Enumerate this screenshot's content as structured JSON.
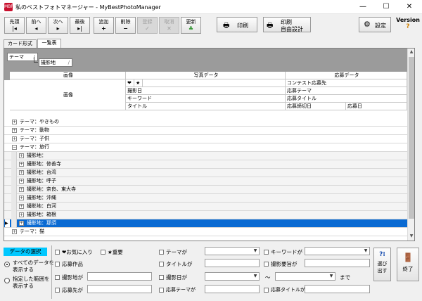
{
  "window": {
    "icon_text": "MBP",
    "title": "私のベストフォトマネージャー - MyBestPhotoManager",
    "minimize": "—",
    "maximize": "☐",
    "close": "✕"
  },
  "toolbar": {
    "first": "先頭",
    "prev": "前へ",
    "next": "次へ",
    "last": "最後",
    "add": "追加",
    "delete": "削除",
    "register": "登録",
    "cancel": "取消",
    "update": "更新",
    "print": "印刷",
    "print_free_line1": "印刷",
    "print_free_line2": "自由設計",
    "settings": "設定",
    "version": "Version",
    "version_mark": "?"
  },
  "tabs": [
    "カード形式",
    "一覧表"
  ],
  "group_panel": {
    "chip1": "テーマ",
    "chip2": "撮影地"
  },
  "columns": {
    "image": "画像",
    "photo_data": "写真データ",
    "entry_data": "応募データ",
    "image_sub": "画像",
    "heart": "❤",
    "star": "★",
    "shoot_date": "撮影日",
    "keyword": "キーワード",
    "title": "タイトル",
    "contest": "コンテスト応募先",
    "entry_theme": "応募テーマ",
    "entry_title": "応募タイトル",
    "deadline": "応募締切日",
    "entry_date": "応募日"
  },
  "rows": [
    {
      "text": "テーマ：やきもの",
      "level": 0,
      "expander": "+"
    },
    {
      "text": "テーマ：動物",
      "level": 0,
      "expander": "+"
    },
    {
      "text": "テーマ：子供",
      "level": 0,
      "expander": "+"
    },
    {
      "text": "テーマ：旅行",
      "level": 0,
      "expander": "−"
    },
    {
      "text": "撮影地：",
      "level": 1,
      "expander": "+"
    },
    {
      "text": "撮影地：修善寺",
      "level": 1,
      "expander": "+"
    },
    {
      "text": "撮影地：台湾",
      "level": 1,
      "expander": "+"
    },
    {
      "text": "撮影地：呼子",
      "level": 1,
      "expander": "+"
    },
    {
      "text": "撮影地：奈良、東大寺",
      "level": 1,
      "expander": "+"
    },
    {
      "text": "撮影地：沖縄",
      "level": 1,
      "expander": "+"
    },
    {
      "text": "撮影地：白河",
      "level": 1,
      "expander": "+"
    },
    {
      "text": "撮影地：箱根",
      "level": 1,
      "expander": "+"
    },
    {
      "text": "撮影地：那須",
      "level": 1,
      "expander": "+",
      "selected": true
    },
    {
      "text": "テーマ：猫",
      "level": 0,
      "expander": "+"
    }
  ],
  "filter": {
    "section_title": "データの選択",
    "radio_all_line1": "すべてのデータを",
    "radio_all_line2": "表示する",
    "radio_range_line1": "指定した範囲を",
    "radio_range_line2": "表示する",
    "favorite": "❤お気に入り",
    "important": "★重要",
    "entry_work": "応募作品",
    "location": "撮影地が",
    "entry_to": "応募先が",
    "theme": "テーマが",
    "title": "タイトルが",
    "shoot_date": "撮影日が",
    "entry_theme": "応募テーマが",
    "keyword": "キーワードが",
    "shoot_note": "撮影要旨が",
    "range_sep": "～",
    "range_end": "まで",
    "entry_title": "応募タイトルが",
    "select_btn_line1": "選び",
    "select_btn_line2": "出す",
    "exit_btn": "終了"
  }
}
